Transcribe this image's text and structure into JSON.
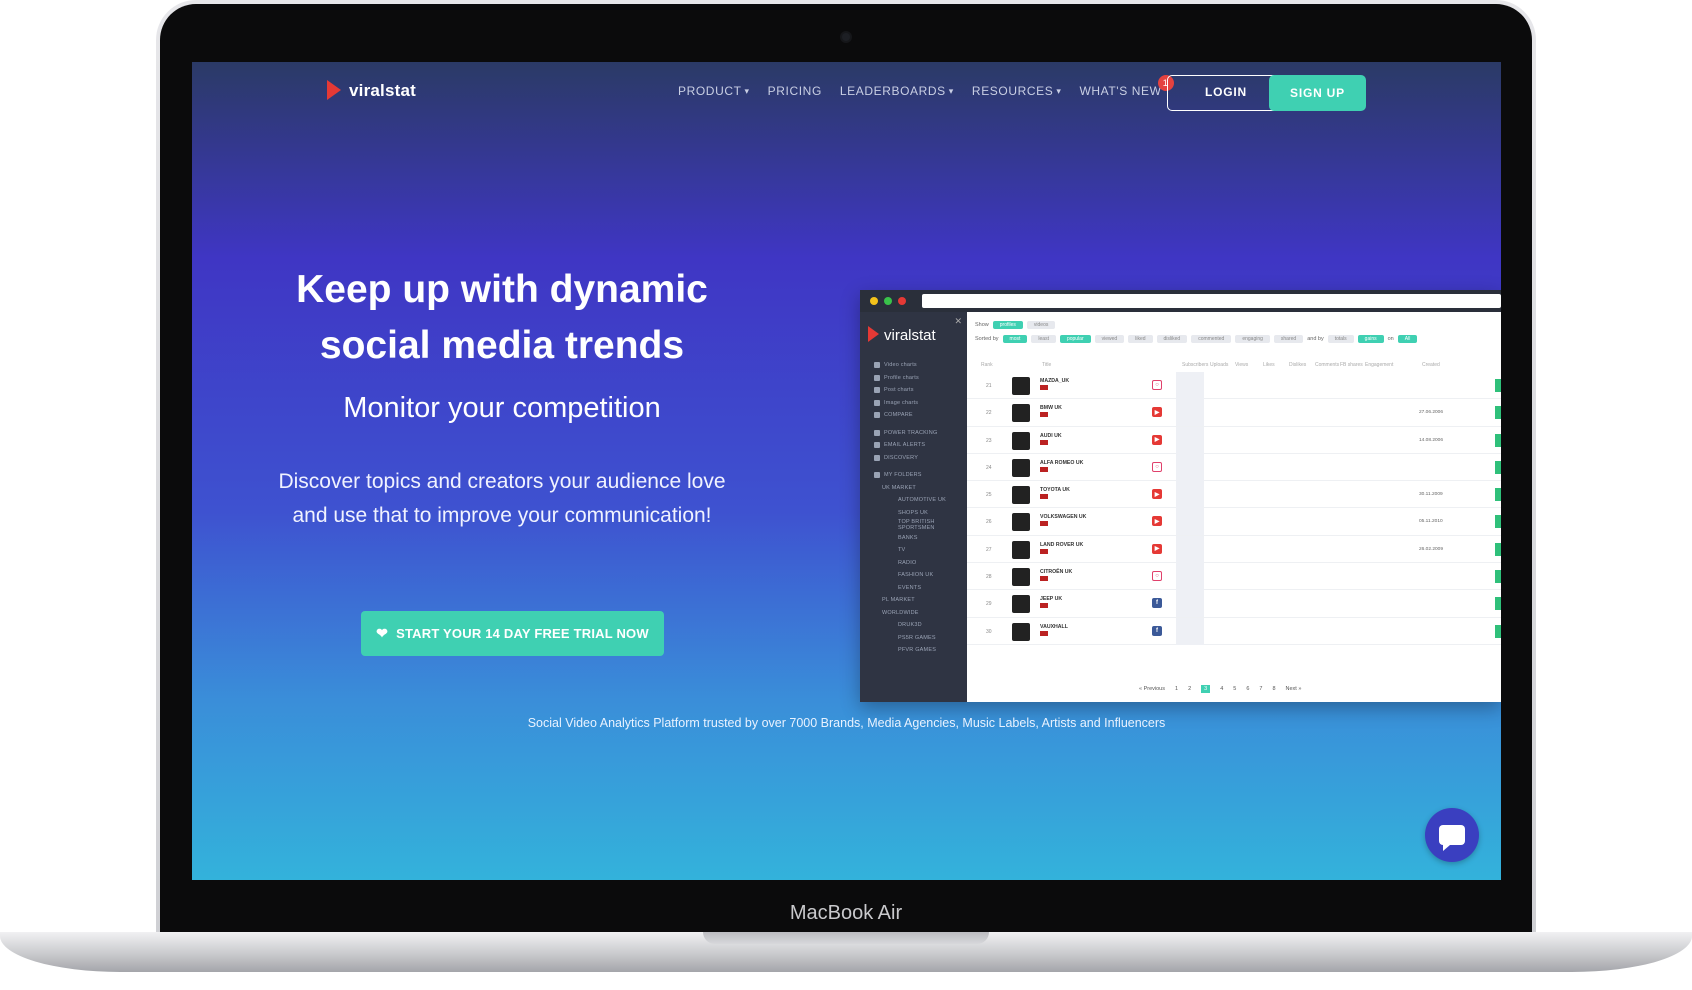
{
  "device": {
    "label": "MacBook Air"
  },
  "nav": {
    "logo": "viralstat",
    "items": [
      {
        "label": "PRODUCT",
        "has_chevron": true
      },
      {
        "label": "PRICING",
        "has_chevron": false
      },
      {
        "label": "LEADERBOARDS",
        "has_chevron": true
      },
      {
        "label": "RESOURCES",
        "has_chevron": true
      },
      {
        "label": "WHAT'S NEW",
        "has_chevron": false
      }
    ],
    "whats_new_badge": "1",
    "login_label": "LOGIN",
    "signup_label": "SIGN UP"
  },
  "hero": {
    "title_line1": "Keep up with dynamic",
    "title_line2": "social media trends",
    "subtitle": "Monitor your competition",
    "body_line1": "Discover topics and creators your audience love",
    "body_line2": "and use that to improve your communication!",
    "cta_label": "START YOUR 14 DAY FREE TRIAL NOW"
  },
  "trusted": "Social Video Analytics Platform trusted by over 7000 Brands, Media Agencies, Music Labels, Artists and Influencers",
  "app_preview": {
    "logo": "viralstat",
    "sidebar": [
      {
        "label": "Video charts",
        "level": 0
      },
      {
        "label": "Profile charts",
        "level": 0
      },
      {
        "label": "Post charts",
        "level": 0
      },
      {
        "label": "Image charts",
        "level": 0
      },
      {
        "label": "COMPARE",
        "level": 0
      },
      {
        "label": "",
        "level": -1
      },
      {
        "label": "POWER TRACKING",
        "level": 0
      },
      {
        "label": "EMAIL ALERTS",
        "level": 0
      },
      {
        "label": "DISCOVERY",
        "level": 0
      },
      {
        "label": "",
        "level": -1
      },
      {
        "label": "MY FOLDERS",
        "level": 0
      },
      {
        "label": "UK MARKET",
        "level": 1
      },
      {
        "label": "AUTOMOTIVE UK",
        "level": 2
      },
      {
        "label": "SHOPS UK",
        "level": 2
      },
      {
        "label": "TOP BRITISH SPORTSMEN",
        "level": 2
      },
      {
        "label": "BANKS",
        "level": 2
      },
      {
        "label": "TV",
        "level": 2
      },
      {
        "label": "RADIO",
        "level": 2
      },
      {
        "label": "FASHION UK",
        "level": 2
      },
      {
        "label": "EVENTS",
        "level": 2
      },
      {
        "label": "PL MARKET",
        "level": 1
      },
      {
        "label": "WORLDWIDE",
        "level": 1
      },
      {
        "label": "DRUK3D",
        "level": 2
      },
      {
        "label": "PS5R GAMES",
        "level": 2
      },
      {
        "label": "PFVR GAMES",
        "level": 2
      }
    ],
    "show_label": "Show",
    "show_tabs": [
      {
        "label": "profiles",
        "on": true
      },
      {
        "label": "videos",
        "on": false
      }
    ],
    "sorted_label": "Sorted by",
    "sort_tabs": [
      {
        "label": "most",
        "on": true
      },
      {
        "label": "least",
        "on": false
      },
      {
        "label": "popular",
        "on": true
      },
      {
        "label": "viewed",
        "on": false
      },
      {
        "label": "liked",
        "on": false
      },
      {
        "label": "disliked",
        "on": false
      },
      {
        "label": "commented",
        "on": false
      },
      {
        "label": "engaging",
        "on": false
      },
      {
        "label": "shared",
        "on": false
      }
    ],
    "and_by_label": "and by",
    "and_by_tabs": [
      {
        "label": "totals",
        "on": false
      },
      {
        "label": "gains",
        "on": true
      }
    ],
    "on_label": "on",
    "on_tabs": [
      {
        "label": "All",
        "on": true
      }
    ],
    "columns": [
      "Rank",
      "Title",
      "Subscribers",
      "Uploads",
      "Views",
      "Likes",
      "Dislikes",
      "Comments",
      "FB shares",
      "Engagement",
      "Created"
    ],
    "rows": [
      {
        "rank": "21",
        "name": "MAZDA_UK",
        "network": "ig",
        "date": ""
      },
      {
        "rank": "22",
        "name": "BMW UK",
        "network": "yt",
        "date": "27.06.2006"
      },
      {
        "rank": "23",
        "name": "AUDI UK",
        "network": "yt",
        "date": "14.08.2006"
      },
      {
        "rank": "24",
        "name": "ALFA ROMEO UK",
        "network": "ig",
        "date": ""
      },
      {
        "rank": "25",
        "name": "TOYOTA UK",
        "network": "yt",
        "date": "30.11.2009"
      },
      {
        "rank": "26",
        "name": "VOLKSWAGEN UK",
        "network": "yt",
        "date": "05.11.2010"
      },
      {
        "rank": "27",
        "name": "LAND ROVER UK",
        "network": "yt",
        "date": "26.02.2009"
      },
      {
        "rank": "28",
        "name": "CITROËN UK",
        "network": "ig",
        "date": ""
      },
      {
        "rank": "29",
        "name": "JEEP UK",
        "network": "fb",
        "date": ""
      },
      {
        "rank": "30",
        "name": "VAUXHALL",
        "network": "fb",
        "date": ""
      }
    ],
    "pager": [
      "« Previous",
      "1",
      "2",
      "3",
      "4",
      "5",
      "6",
      "7",
      "8",
      "Next »"
    ],
    "pager_current": "3"
  },
  "colors": {
    "accent": "#3fd0b2",
    "brand_red": "#e53935",
    "badge": "#e4423f",
    "chat_button": "#3a3fc0"
  },
  "icons": {
    "cta": "heart-icon",
    "chat": "chat-icon"
  }
}
